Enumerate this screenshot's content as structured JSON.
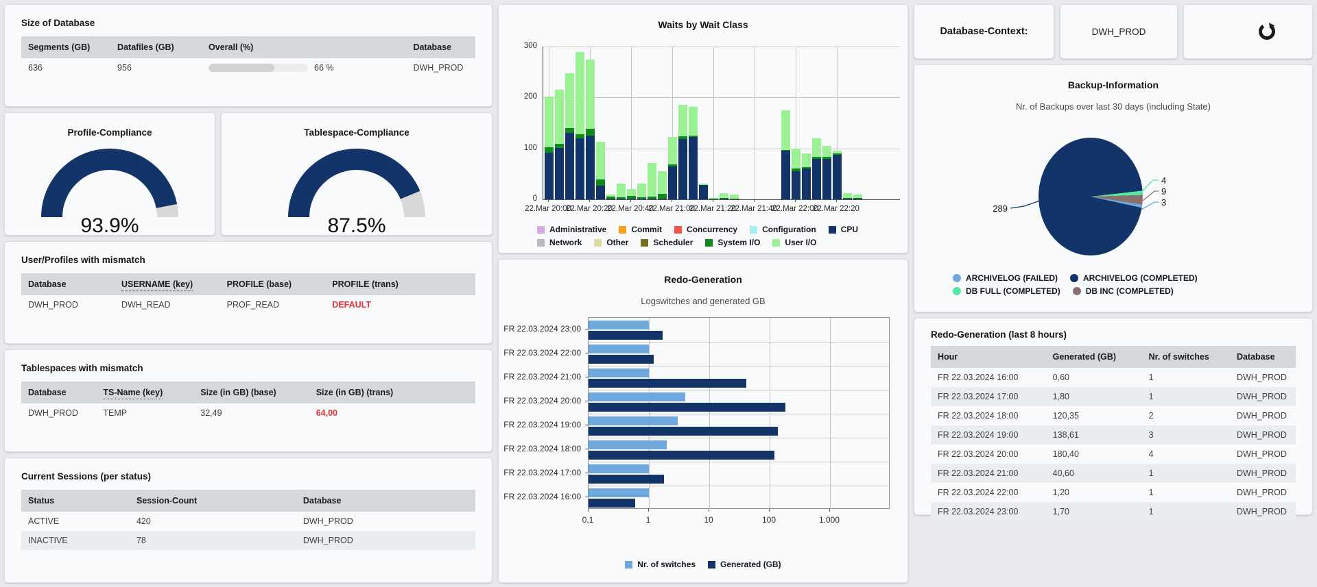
{
  "colors": {
    "navy": "#123468",
    "user_io_green": "#9bf294",
    "system_io_green": "#0d8a1b",
    "light_blue": "#6fa8dc",
    "pie_green": "#54e8a4",
    "pie_brown": "#8a716d",
    "gauge_rest": "#d8d8d8",
    "alert_red": "#e43131"
  },
  "left": {
    "size_panel": {
      "title": "Size of Database",
      "table": {
        "cols": [
          {
            "t": "Segments (GB)"
          },
          {
            "t": "Datafiles (GB)"
          },
          {
            "t": "Overall (%)"
          },
          {
            "t": "Database"
          }
        ],
        "rows": [
          [
            "636",
            "956",
            {
              "progress": true,
              "percent": 66,
              "label": "66 %"
            },
            "DWH_PROD"
          ]
        ]
      }
    },
    "gauges": [
      {
        "title": "Profile-Compliance",
        "value": 93.9,
        "value_label": "93.9%"
      },
      {
        "title": "Tablespace-Compliance",
        "value": 87.5,
        "value_label": "87.5%"
      }
    ],
    "user_profiles_panel": {
      "title": "User/Profiles with mismatch",
      "table": {
        "cols": [
          {
            "t": "Database"
          },
          {
            "t": "USERNAME (key)",
            "key": true
          },
          {
            "t": "PROFILE (base)"
          },
          {
            "t": "PROFILE (trans)"
          }
        ],
        "rows": [
          [
            "DWH_PROD",
            "DWH_READ",
            "PROF_READ",
            {
              "t": "DEFAULT",
              "red": true
            }
          ]
        ]
      }
    },
    "tablespaces_panel": {
      "title": "Tablespaces with mismatch",
      "table": {
        "cols": [
          {
            "t": "Database"
          },
          {
            "t": "TS-Name (key)",
            "key": true
          },
          {
            "t": "Size (in GB) (base)"
          },
          {
            "t": "Size (in GB) (trans)"
          }
        ],
        "rows": [
          [
            "DWH_PROD",
            "TEMP",
            "32,49",
            {
              "t": "64,00",
              "red": true
            }
          ]
        ]
      }
    },
    "sessions_panel": {
      "title": "Current Sessions (per status)",
      "table": {
        "cols": [
          {
            "t": "Status"
          },
          {
            "t": "Session-Count"
          },
          {
            "t": "Database"
          }
        ],
        "rows": [
          [
            "ACTIVE",
            "420",
            "DWH_PROD"
          ],
          [
            "INACTIVE",
            "78",
            "DWH_PROD"
          ]
        ]
      }
    }
  },
  "right": {
    "context": {
      "label": "Database-Context:",
      "value": "DWH_PROD",
      "refresh_icon": "refresh-icon"
    },
    "backup": {
      "title": "Backup-Information",
      "subtitle": "Nr. of Backups over last 30 days (including State)"
    },
    "redo_panel": {
      "title": "Redo-Generation (last 8 hours)",
      "table": {
        "cols": [
          {
            "t": "Hour"
          },
          {
            "t": "Generated (GB)"
          },
          {
            "t": "Nr. of switches"
          },
          {
            "t": "Database"
          }
        ],
        "rows": [
          [
            "FR 22.03.2024 16:00",
            "0,60",
            "1",
            "DWH_PROD"
          ],
          [
            "FR 22.03.2024 17:00",
            "1,80",
            "1",
            "DWH_PROD"
          ],
          [
            "FR 22.03.2024 18:00",
            "120,35",
            "2",
            "DWH_PROD"
          ],
          [
            "FR 22.03.2024 19:00",
            "138,61",
            "3",
            "DWH_PROD"
          ],
          [
            "FR 22.03.2024 20:00",
            "180,40",
            "4",
            "DWH_PROD"
          ],
          [
            "FR 22.03.2024 21:00",
            "40,60",
            "1",
            "DWH_PROD"
          ],
          [
            "FR 22.03.2024 22:00",
            "1,20",
            "1",
            "DWH_PROD"
          ],
          [
            "FR 22.03.2024 23:00",
            "1,70",
            "1",
            "DWH_PROD"
          ]
        ]
      }
    }
  },
  "chart_data": {
    "waits": {
      "type": "bar",
      "stacked": true,
      "title": "Waits by Wait Class",
      "ylim": [
        0,
        300
      ],
      "yticks": [
        0,
        100,
        200,
        300
      ],
      "x_tick_labels": [
        "22.Mar 20:00",
        "22.Mar 20:20",
        "22.Mar 20:40",
        "22.Mar 21:00",
        "22.Mar 21:20",
        "22.Mar 21:40",
        "22.Mar 22:00",
        "22.Mar 22:20"
      ],
      "x_slot_minutes": 5,
      "series": [
        {
          "name": "CPU",
          "color": "#123468",
          "values": [
            92,
            101,
            131,
            120,
            125,
            27,
            2,
            1,
            1,
            1,
            1,
            2,
            64,
            119,
            122,
            28,
            0,
            1,
            0,
            0,
            0,
            0,
            0,
            95,
            55,
            60,
            80,
            80,
            88,
            2,
            1
          ]
        },
        {
          "name": "System I/O",
          "color": "#0d8a1b",
          "values": [
            10,
            8,
            9,
            8,
            14,
            12,
            4,
            3,
            6,
            3,
            4,
            9,
            4,
            5,
            3,
            0,
            1,
            2,
            2,
            0,
            0,
            0,
            0,
            2,
            5,
            3,
            3,
            3,
            2,
            1,
            2
          ]
        },
        {
          "name": "User I/O",
          "color": "#9bf294",
          "values": [
            100,
            106,
            108,
            161,
            136,
            74,
            3,
            27,
            13,
            27,
            66,
            44,
            54,
            62,
            56,
            3,
            2,
            9,
            8,
            0,
            0,
            0,
            0,
            78,
            40,
            27,
            37,
            22,
            5,
            9,
            7
          ]
        }
      ],
      "legend": [
        {
          "label": "Administrative",
          "color": "#d9a7e3"
        },
        {
          "label": "Commit",
          "color": "#f5a11d"
        },
        {
          "label": "Concurrency",
          "color": "#f4534f"
        },
        {
          "label": "Configuration",
          "color": "#a9eef0"
        },
        {
          "label": "CPU",
          "color": "#123468"
        },
        {
          "label": "Network",
          "color": "#b9babd"
        },
        {
          "label": "Other",
          "color": "#dedc9e"
        },
        {
          "label": "Scheduler",
          "color": "#70701e"
        },
        {
          "label": "System I/O",
          "color": "#0d8a1b"
        },
        {
          "label": "User I/O",
          "color": "#9bf294"
        }
      ]
    },
    "redo": {
      "type": "bar",
      "orientation": "horizontal",
      "xscale": "log",
      "title": "Redo-Generation",
      "subtitle": "Logswitches and generated GB",
      "categories": [
        "FR 22.03.2024 23:00",
        "FR 22.03.2024 22:00",
        "FR 22.03.2024 21:00",
        "FR 22.03.2024 20:00",
        "FR 22.03.2024 19:00",
        "FR 22.03.2024 18:00",
        "FR 22.03.2024 17:00",
        "FR 22.03.2024 16:00"
      ],
      "x_tick_labels": [
        "0,1",
        "1",
        "10",
        "100",
        "1.000"
      ],
      "series": [
        {
          "name": "Nr. of switches",
          "color": "#6fa8dc",
          "values": [
            1,
            1,
            1,
            4,
            3,
            2,
            1,
            1
          ]
        },
        {
          "name": "Generated (GB)",
          "color": "#123468",
          "values": [
            1.7,
            1.2,
            40.6,
            180.4,
            138.61,
            120.35,
            1.8,
            0.6
          ]
        }
      ]
    },
    "backup_pie": {
      "type": "pie",
      "title": "Backup-Information",
      "subtitle": "Nr. of Backups over last 30 days (including State)",
      "slices": [
        {
          "label": "ARCHIVELOG (COMPLETED)",
          "value": 289,
          "color": "#123468"
        },
        {
          "label": "DB FULL (COMPLETED)",
          "value": 4,
          "color": "#54e8a4"
        },
        {
          "label": "DB INC (COMPLETED)",
          "value": 9,
          "color": "#8a716d"
        },
        {
          "label": "ARCHIVELOG (FAILED)",
          "value": 3,
          "color": "#6fa8dc"
        }
      ],
      "legend": [
        {
          "label": "ARCHIVELOG (FAILED)",
          "color": "#6fa8dc"
        },
        {
          "label": "ARCHIVELOG (COMPLETED)",
          "color": "#123468"
        },
        {
          "label": "DB FULL (COMPLETED)",
          "color": "#54e8a4"
        },
        {
          "label": "DB INC (COMPLETED)",
          "color": "#8a716d"
        }
      ]
    }
  }
}
